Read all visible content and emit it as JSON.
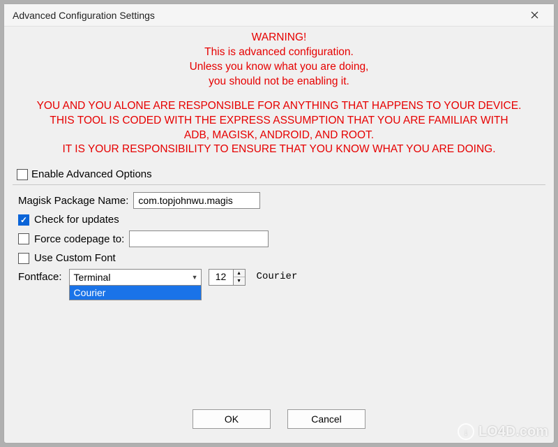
{
  "titlebar": {
    "title": "Advanced Configuration Settings"
  },
  "warning": {
    "l1": "WARNING!",
    "l2": "This is advanced configuration.",
    "l3": "Unless you know what you are doing,",
    "l4": "you should not be enabling it.",
    "s1": "YOU AND YOU ALONE ARE RESPONSIBLE FOR ANYTHING THAT HAPPENS TO YOUR DEVICE.",
    "s2": "THIS TOOL IS CODED WITH THE EXPRESS ASSUMPTION THAT YOU ARE FAMILIAR WITH",
    "s3": "ADB, MAGISK, ANDROID, AND ROOT.",
    "s4": "IT IS YOUR RESPONSIBILITY TO ENSURE THAT YOU KNOW WHAT YOU ARE DOING."
  },
  "enable_advanced": {
    "label": "Enable Advanced Options",
    "checked": false
  },
  "magisk": {
    "label": "Magisk Package Name:",
    "value": "com.topjohnwu.magis"
  },
  "check_updates": {
    "label": "Check for updates",
    "checked": true
  },
  "force_codepage": {
    "label": "Force codepage to:",
    "checked": false,
    "value": ""
  },
  "custom_font": {
    "label": "Use Custom Font",
    "checked": false
  },
  "fontface": {
    "label": "Fontface:",
    "selected": "Terminal",
    "highlighted": "Courier",
    "options": [
      "Terminal",
      "Courier"
    ],
    "size": "12",
    "preview_name": "Courier"
  },
  "buttons": {
    "ok": "OK",
    "cancel": "Cancel"
  },
  "watermark": "LO4D.com"
}
